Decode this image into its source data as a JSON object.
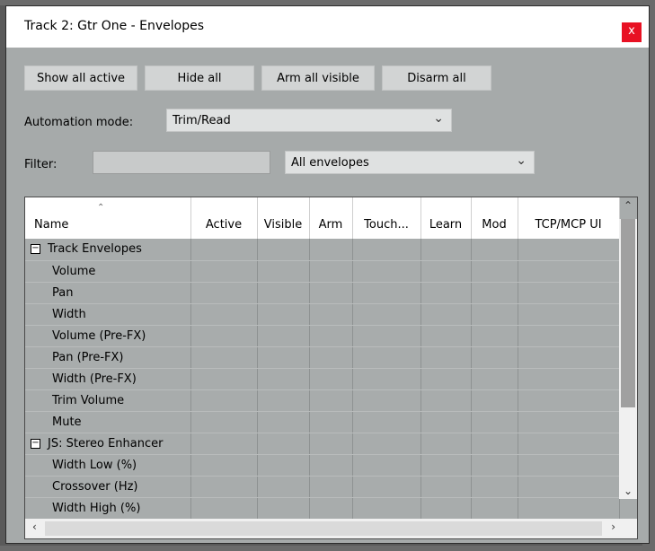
{
  "window": {
    "title": "Track 2: Gtr One - Envelopes",
    "close_glyph": "x"
  },
  "buttons": {
    "show_all_active": "Show all active",
    "hide_all": "Hide all",
    "arm_all_visible": "Arm all visible",
    "disarm_all": "Disarm all"
  },
  "automation": {
    "label": "Automation mode:",
    "value": "Trim/Read"
  },
  "filter": {
    "label": "Filter:",
    "value": "",
    "dropdown_value": "All envelopes"
  },
  "table": {
    "columns": [
      "Name",
      "Active",
      "Visible",
      "Arm",
      "Touch...",
      "Learn",
      "Mod",
      "TCP/MCP UI"
    ],
    "rows": [
      {
        "name": "Track Envelopes",
        "group": true
      },
      {
        "name": "Volume",
        "group": false
      },
      {
        "name": "Pan",
        "group": false
      },
      {
        "name": "Width",
        "group": false
      },
      {
        "name": "Volume (Pre-FX)",
        "group": false
      },
      {
        "name": "Pan (Pre-FX)",
        "group": false
      },
      {
        "name": "Width (Pre-FX)",
        "group": false
      },
      {
        "name": "Trim Volume",
        "group": false
      },
      {
        "name": "Mute",
        "group": false
      },
      {
        "name": "JS: Stereo Enhancer",
        "group": true
      },
      {
        "name": "Width Low (%)",
        "group": false
      },
      {
        "name": "Crossover (Hz)",
        "group": false
      },
      {
        "name": "Width High (%)",
        "group": false
      }
    ]
  },
  "icons": {
    "sort": "sort-ascending-icon",
    "expand": "collapse-box-icon",
    "chevron": "chevron-down-icon",
    "scroll_up": "arrow-up-icon",
    "scroll_down": "arrow-down-icon",
    "scroll_left": "arrow-left-icon",
    "scroll_right": "arrow-right-icon"
  }
}
